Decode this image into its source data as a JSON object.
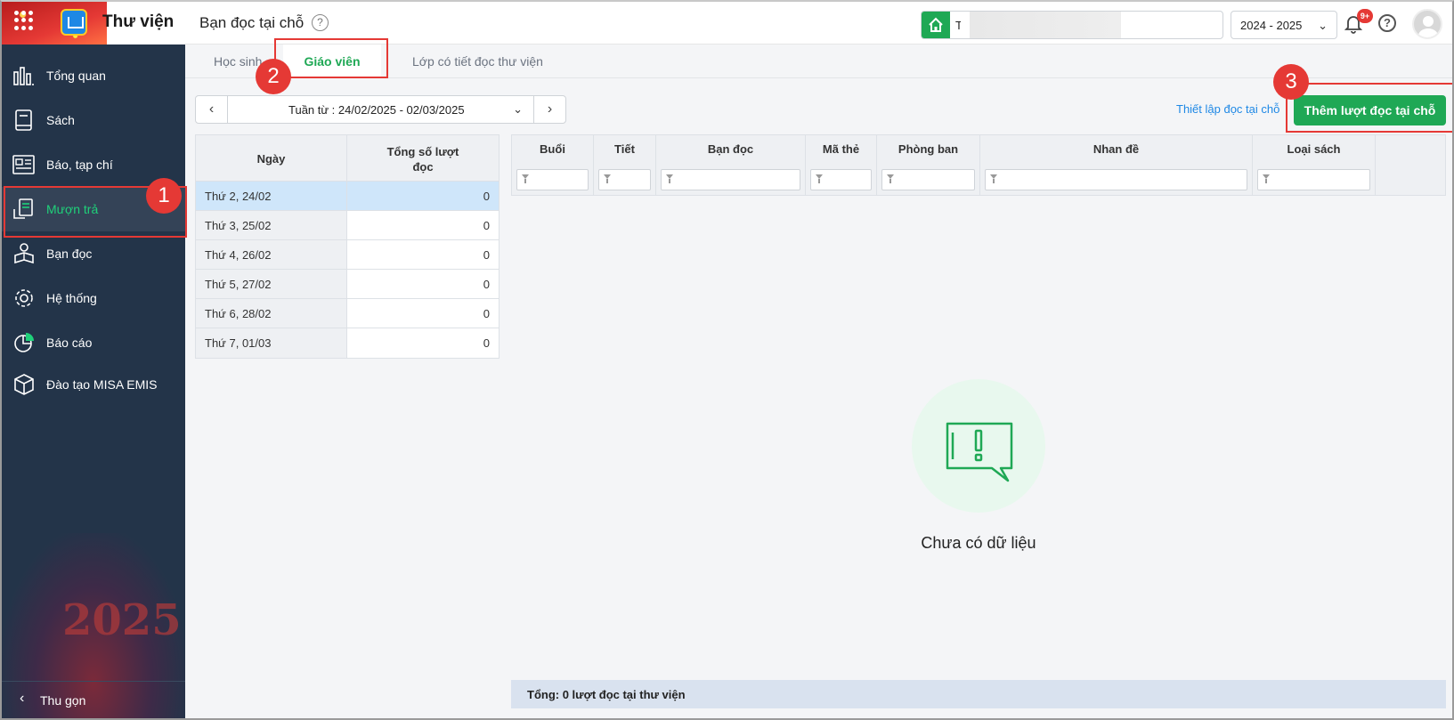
{
  "app": {
    "title": "Thư viện",
    "page_title": "Bạn đọc tại chỗ",
    "help_symbol": "?",
    "school_prefix": "T",
    "year": "2024 - 2025",
    "notif_badge": "9+",
    "accent": "#1fa855"
  },
  "sidebar": {
    "items": [
      {
        "label": "Tổng quan",
        "icon": "bar-chart-icon"
      },
      {
        "label": "Sách",
        "icon": "book-icon"
      },
      {
        "label": "Báo, tạp chí",
        "icon": "newspaper-icon"
      },
      {
        "label": "Mượn trả",
        "icon": "borrow-return-icon",
        "active": true
      },
      {
        "label": "Bạn đọc",
        "icon": "reader-icon"
      },
      {
        "label": "Hệ thống",
        "icon": "gear-icon"
      },
      {
        "label": "Báo cáo",
        "icon": "pie-chart-icon"
      },
      {
        "label": "Đào tạo MISA EMIS",
        "icon": "cube-icon"
      }
    ],
    "collapse_label": "Thu gọn",
    "art_year": "2025"
  },
  "tabs": [
    {
      "label": "Học sinh"
    },
    {
      "label": "Giáo viên",
      "active": true
    },
    {
      "label": "Lớp có tiết đọc thư viện"
    }
  ],
  "week": {
    "label": "Tuần từ : 24/02/2025 - 02/03/2025",
    "prev": "‹",
    "next": "›",
    "dropdown": "⌄"
  },
  "actions": {
    "setup_link": "Thiết lập đọc tại chỗ",
    "add_button": "Thêm lượt đọc tại chỗ"
  },
  "day_table": {
    "headers": {
      "day": "Ngày",
      "total": "Tổng số lượt đọc"
    },
    "rows": [
      {
        "day": "Thứ 2, 24/02",
        "count": "0",
        "selected": true
      },
      {
        "day": "Thứ 3, 25/02",
        "count": "0"
      },
      {
        "day": "Thứ 4, 26/02",
        "count": "0"
      },
      {
        "day": "Thứ 5, 27/02",
        "count": "0"
      },
      {
        "day": "Thứ 6, 28/02",
        "count": "0"
      },
      {
        "day": "Thứ 7, 01/03",
        "count": "0"
      }
    ]
  },
  "detail_table": {
    "columns": [
      "Buổi",
      "Tiết",
      "Bạn đọc",
      "Mã thẻ",
      "Phòng ban",
      "Nhan đề",
      "Loại sách",
      ""
    ]
  },
  "empty_state": {
    "text": "Chưa có dữ liệu"
  },
  "footer": {
    "total": "Tổng: 0 lượt đọc tại thư viện"
  },
  "annotations": [
    "1",
    "2",
    "3"
  ]
}
